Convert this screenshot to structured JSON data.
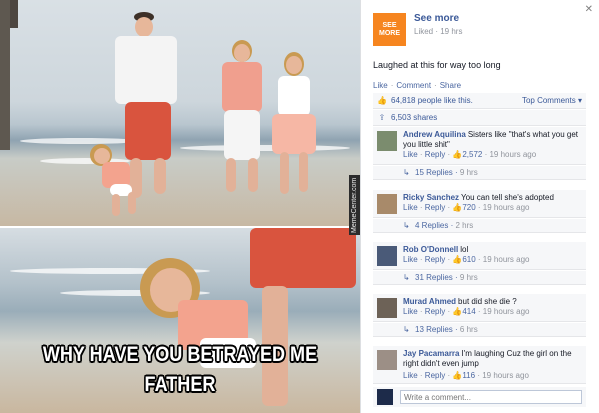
{
  "photo": {
    "watermark": "MemeCenter.com",
    "caption_line1": "WHY HAVE YOU BETRAYED ME",
    "caption_line2": "FATHER"
  },
  "post": {
    "page_logo": "SEE MORE",
    "page_name": "See more",
    "meta": "Liked · 19 hrs",
    "close": "✕",
    "text": "Laughed at this for way too long",
    "actions": [
      "Like",
      "Comment",
      "Share"
    ],
    "likes": "64,818 people like this.",
    "top_comments": "Top Comments ▾",
    "shares": "6,503 shares"
  },
  "comments": [
    {
      "author": "Andrew Aquilina",
      "text": "Sisters like \"that's what you get you little shit\"",
      "like": "Like",
      "reply": "Reply",
      "count": "2,572",
      "time": "19 hours ago",
      "replies": "15 Replies",
      "replies_time": "9 hrs"
    },
    {
      "author": "Ricky Sanchez",
      "text": "You can tell she's adopted",
      "like": "Like",
      "reply": "Reply",
      "count": "720",
      "time": "19 hours ago",
      "replies": "4 Replies",
      "replies_time": "2 hrs"
    },
    {
      "author": "Rob O'Donnell",
      "text": "lol",
      "like": "Like",
      "reply": "Reply",
      "count": "610",
      "time": "19 hours ago",
      "replies": "31 Replies",
      "replies_time": "9 hrs"
    },
    {
      "author": "Murad Ahmed",
      "text": "but did she die ?",
      "like": "Like",
      "reply": "Reply",
      "count": "414",
      "time": "19 hours ago",
      "replies": "13 Replies",
      "replies_time": "6 hrs"
    },
    {
      "author": "Jay Pacamarra",
      "text": "I'm laughing Cuz the girl on the right didn't even jump",
      "like": "Like",
      "reply": "Reply",
      "count": "116",
      "time": "19 hours ago"
    }
  ],
  "write_comment": {
    "placeholder": "Write a comment..."
  },
  "colors": {
    "link": "#3b5998",
    "logo": "#f6851f",
    "muted": "#90949c"
  }
}
